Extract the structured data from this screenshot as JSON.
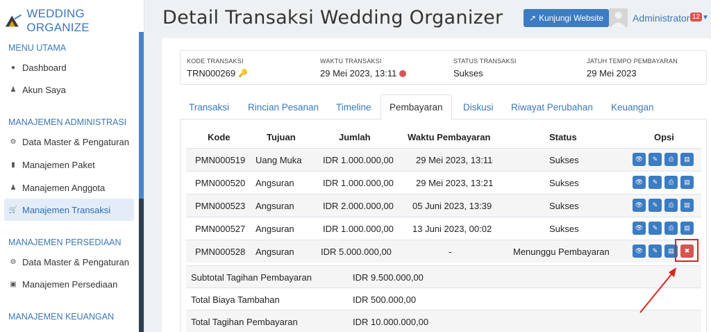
{
  "brand": {
    "name": "WEDDING ORGANIZE"
  },
  "sidebar": {
    "sections": [
      {
        "title": "MENU UTAMA"
      },
      {
        "title": "MANAJEMEN ADMINISTRASI"
      },
      {
        "title": "MANAJEMEN PERSEDIAAN"
      },
      {
        "title": "MANAJEMEN KEUANGAN"
      }
    ],
    "items": [
      {
        "label": "Dashboard",
        "icon": "palette-icon"
      },
      {
        "label": "Akun Saya",
        "icon": "user-icon"
      },
      {
        "label": "Data Master & Pengaturan",
        "icon": "gears-icon"
      },
      {
        "label": "Manajemen Paket",
        "icon": "book-icon"
      },
      {
        "label": "Manajemen Anggota",
        "icon": "users-icon"
      },
      {
        "label": "Manajemen Transaksi",
        "icon": "cart-icon",
        "active": true
      },
      {
        "label": "Data Master & Pengaturan",
        "icon": "gears-icon"
      },
      {
        "label": "Manajemen Persediaan",
        "icon": "cubes-icon"
      }
    ]
  },
  "header": {
    "title": "Detail Transaksi Wedding Organizer",
    "website_button": "Kunjungi Website",
    "user_name": "Administrator",
    "notification_count": "12"
  },
  "info": {
    "kode_label": "KODE TRANSAKSI",
    "kode_value": "TRN000269",
    "waktu_label": "WAKTU TRANSAKSI",
    "waktu_value": "29 Mei 2023, 13:11",
    "status_label": "STATUS TRANSAKSI",
    "status_value": "Sukses",
    "jatuh_label": "JATUH TEMPO PEMBAYARAN",
    "jatuh_value": "29 Mei 2023"
  },
  "tabs": [
    "Transaksi",
    "Rincian Pesanan",
    "Timeline",
    "Pembayaran",
    "Diskusi",
    "Riwayat Perubahan",
    "Keuangan"
  ],
  "active_tab": "Pembayaran",
  "table": {
    "headers": [
      "Kode",
      "Tujuan",
      "Jumlah",
      "Waktu Pembayaran",
      "Status",
      "Opsi"
    ],
    "rows": [
      {
        "kode": "PMN000519",
        "tujuan": "Uang Muka",
        "jumlah": "IDR 1.000.000,00",
        "waktu": "29 Mei 2023, 13:11",
        "status": "Sukses"
      },
      {
        "kode": "PMN000520",
        "tujuan": "Angsuran",
        "jumlah": "IDR 1.000.000,00",
        "waktu": "29 Mei 2023, 13:21",
        "status": "Sukses"
      },
      {
        "kode": "PMN000523",
        "tujuan": "Angsuran",
        "jumlah": "IDR 2.000.000,00",
        "waktu": "05 Juni 2023, 13:39",
        "status": "Sukses"
      },
      {
        "kode": "PMN000527",
        "tujuan": "Angsuran",
        "jumlah": "IDR 1.000.000,00",
        "waktu": "13 Juni 2023, 00:02",
        "status": "Sukses"
      },
      {
        "kode": "PMN000528",
        "tujuan": "Angsuran",
        "jumlah": "IDR 5.000.000,00",
        "waktu": "-",
        "status": "Menunggu Pembayaran"
      }
    ]
  },
  "summary": [
    {
      "label": "Subtotal Tagihan Pembayaran",
      "value": "IDR 9.500.000,00"
    },
    {
      "label": "Total Biaya Tambahan",
      "value": "IDR 500.000,00"
    },
    {
      "label": "Total Tagihan Pembayaran",
      "value": "IDR 10.000.000,00"
    }
  ],
  "colors": {
    "primary": "#3b7cc2",
    "danger": "#d9534f",
    "annotation": "#e0221d"
  }
}
